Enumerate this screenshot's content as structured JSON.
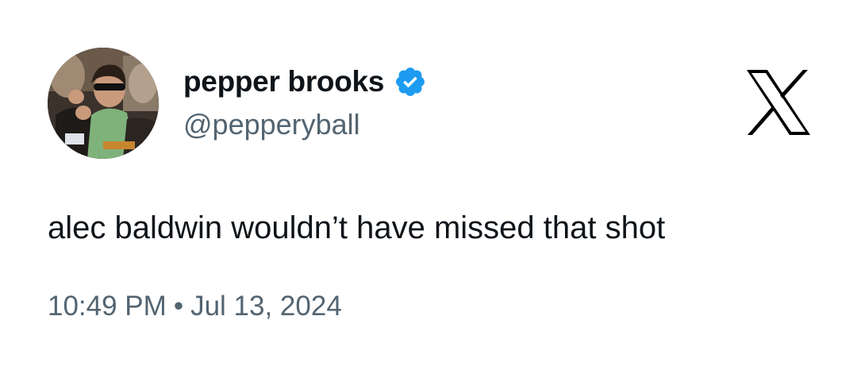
{
  "author": {
    "display_name": "pepper brooks",
    "handle": "@pepperyball",
    "verified": true,
    "avatar_icon": "profile-photo"
  },
  "brand": {
    "logo_icon": "x-logo-icon",
    "color": "#000000"
  },
  "tweet": {
    "text": "alec baldwin wouldn’t have missed that shot",
    "time": "10:49 PM",
    "separator": "•",
    "date": "Jul 13, 2024"
  },
  "colors": {
    "primary_text": "#0f1419",
    "secondary_text": "#536471",
    "verified_badge": "#1d9bf0",
    "background": "#ffffff"
  }
}
